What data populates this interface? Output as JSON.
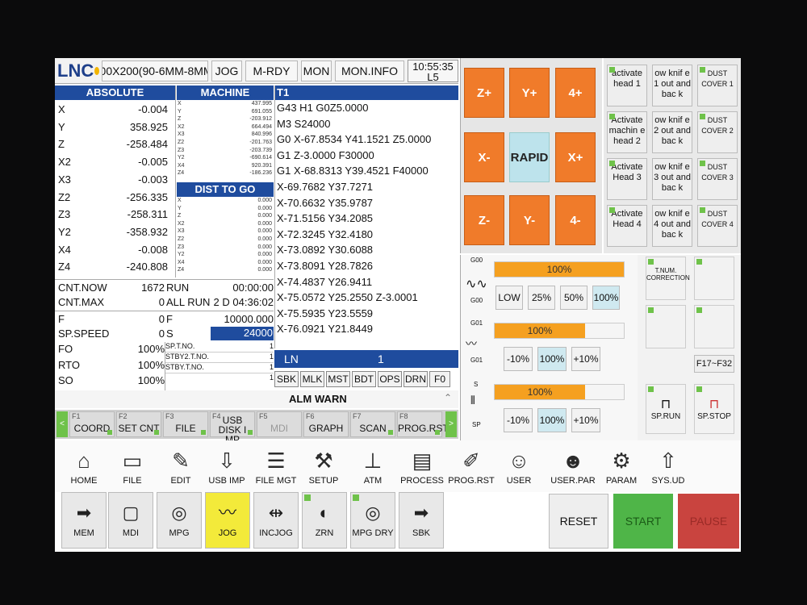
{
  "topbar": {
    "logo": "LNC",
    "program": "200X200(90-6MM-8MM(",
    "mode": "JOG",
    "status": "M-RDY",
    "mon": "MON",
    "mon_info": "MON.INFO",
    "time": "10:55:35",
    "level": "L5"
  },
  "absolute": {
    "title": "ABSOLUTE",
    "rows": [
      {
        "axis": "X",
        "value": "-0.004"
      },
      {
        "axis": "Y",
        "value": "358.925"
      },
      {
        "axis": "Z",
        "value": "-258.484"
      },
      {
        "axis": "X2",
        "value": "-0.005"
      },
      {
        "axis": "X3",
        "value": "-0.003"
      },
      {
        "axis": "Z2",
        "value": "-256.335"
      },
      {
        "axis": "Z3",
        "value": "-258.311"
      },
      {
        "axis": "Y2",
        "value": "-358.932"
      },
      {
        "axis": "X4",
        "value": "-0.008"
      },
      {
        "axis": "Z4",
        "value": "-240.808"
      }
    ]
  },
  "machine": {
    "title": "MACHINE",
    "rows": [
      {
        "axis": "X",
        "value": "437.995"
      },
      {
        "axis": "Y",
        "value": "691.055"
      },
      {
        "axis": "Z",
        "value": "-203.912"
      },
      {
        "axis": "X2",
        "value": "664.494"
      },
      {
        "axis": "X3",
        "value": "840.996"
      },
      {
        "axis": "Z2",
        "value": "-201.763"
      },
      {
        "axis": "Z3",
        "value": "-203.739"
      },
      {
        "axis": "Y2",
        "value": "-690.614"
      },
      {
        "axis": "X4",
        "value": "920.391"
      },
      {
        "axis": "Z4",
        "value": "-186.236"
      }
    ]
  },
  "dist": {
    "title": "DIST TO GO",
    "rows": [
      {
        "axis": "X",
        "value": "0.000"
      },
      {
        "axis": "Y",
        "value": "0.000"
      },
      {
        "axis": "Z",
        "value": "0.000"
      },
      {
        "axis": "X2",
        "value": "0.000"
      },
      {
        "axis": "X3",
        "value": "0.000"
      },
      {
        "axis": "Z2",
        "value": "0.000"
      },
      {
        "axis": "Z3",
        "value": "0.000"
      },
      {
        "axis": "Y2",
        "value": "0.000"
      },
      {
        "axis": "X4",
        "value": "0.000"
      },
      {
        "axis": "Z4",
        "value": "0.000"
      }
    ]
  },
  "counters": {
    "cnt_now_label": "CNT.NOW",
    "cnt_now_value": "1672",
    "cnt_max_label": "CNT.MAX",
    "cnt_max_value": "0",
    "run_label": "RUN",
    "run_value": "00:00:00",
    "all_run_label": "ALL RUN",
    "all_run_value": "2 D 04:36:02"
  },
  "feeds": {
    "f_label": "F",
    "f_value": "0",
    "f_cmd_label": "F",
    "f_cmd_value": "10000.000",
    "sp_label": "SP.SPEED",
    "sp_value": "0",
    "s_label": "S",
    "s_value": "24000",
    "fo_label": "FO",
    "fo_value": "100%",
    "rto_label": "RTO",
    "rto_value": "100%",
    "so_label": "SO",
    "so_value": "100%",
    "spt_label": "SP.T.NO.",
    "spt_value": "1",
    "stby2_label": "STBY2.T.NO.",
    "stby2_value": "1",
    "stby_label": "STBY.T.NO.",
    "stby_value": "1",
    "extra_value": "1"
  },
  "program": {
    "title": "T1",
    "lines": [
      "G43 H1 G0Z5.0000",
      "M3 S24000",
      "G0 X-67.8534 Y41.1521 Z5.0000",
      "G1   Z-3.0000 F30000",
      "G1  X-68.8313 Y39.4521  F40000",
      "X-69.7682 Y37.7271",
      "X-70.6632 Y35.9787",
      "X-71.5156 Y34.2085",
      "X-72.3245 Y32.4180",
      "X-73.0892 Y30.6088",
      "X-73.8091 Y28.7826",
      "X-74.4837 Y26.9411",
      "X-75.0572 Y25.2550 Z-3.0001",
      "X-75.5935 Y23.5559",
      "X-76.0921 Y21.8449"
    ],
    "ln_label": "LN",
    "ln_value": "1",
    "flags": [
      "SBK",
      "MLK",
      "MST",
      "BDT",
      "OPS",
      "DRN",
      "F0"
    ],
    "alm": "ALM",
    "warn": "WARN"
  },
  "fkeys": [
    {
      "fn": "F1",
      "label": "COORD"
    },
    {
      "fn": "F2",
      "label": "SET CNT"
    },
    {
      "fn": "F3",
      "label": "FILE"
    },
    {
      "fn": "F4",
      "label": "USB DISK I MP"
    },
    {
      "fn": "F5",
      "label": "MDI"
    },
    {
      "fn": "F6",
      "label": "GRAPH"
    },
    {
      "fn": "F7",
      "label": "SCAN OPEN"
    },
    {
      "fn": "F8",
      "label": "PROG.RST"
    }
  ],
  "icons": [
    {
      "label": "HOME",
      "icon": "home-icon",
      "glyph": "⌂"
    },
    {
      "label": "FILE",
      "icon": "folder-icon",
      "glyph": "▭"
    },
    {
      "label": "EDIT",
      "icon": "edit-icon",
      "glyph": "✎"
    },
    {
      "label": "USB IMP",
      "icon": "usb-icon",
      "glyph": "⇩"
    },
    {
      "label": "FILE MGT",
      "icon": "file-manager-icon",
      "glyph": "☰"
    },
    {
      "label": "SETUP",
      "icon": "setup-icon",
      "glyph": "⚒"
    },
    {
      "label": "ATM",
      "icon": "tool-magazine-icon",
      "glyph": "⊥"
    },
    {
      "label": "PROCESS",
      "icon": "process-icon",
      "glyph": "▤"
    },
    {
      "label": "PROG.RST",
      "icon": "program-reset-icon",
      "glyph": "✐"
    },
    {
      "label": "USER",
      "icon": "user-icon",
      "glyph": "☺"
    },
    {
      "label": "USER.PAR",
      "icon": "user-param-icon",
      "glyph": "☻"
    },
    {
      "label": "PARAM",
      "icon": "gear-icon",
      "glyph": "⚙"
    },
    {
      "label": "SYS.UD",
      "icon": "upload-icon",
      "glyph": "⇧"
    }
  ],
  "modes": [
    {
      "label": "MEM",
      "glyph": "➡"
    },
    {
      "label": "MDI",
      "glyph": "▢"
    },
    {
      "label": "MPG",
      "glyph": "◎"
    },
    {
      "label": "JOG",
      "glyph": "〰"
    },
    {
      "label": "INCJOG",
      "glyph": "⇹"
    },
    {
      "label": "ZRN",
      "glyph": "◐"
    },
    {
      "label": "MPG DRY",
      "glyph": "◎"
    },
    {
      "label": "SBK",
      "glyph": "➡"
    }
  ],
  "actions": {
    "reset": "RESET",
    "start": "START",
    "pause": "PAUSE"
  },
  "jog": {
    "zplus": "Z+",
    "yplus": "Y+",
    "aplus": "4+",
    "xminus": "X-",
    "rapid": "RAPID",
    "xplus": "X+",
    "zminus": "Z-",
    "yminus": "Y-",
    "aminus": "4-"
  },
  "heads": [
    {
      "activate": "activate head 1",
      "knife": "ow knif e 1 out and bac k",
      "dust": "DUST COVER 1"
    },
    {
      "activate": "Activate machin e head 2",
      "knife": "ow knif e 2 out and bac k",
      "dust": "DUST COVER 2"
    },
    {
      "activate": "Activate Head 3",
      "knife": "ow knif e 3 out and bac k",
      "dust": "DUST COVER 3"
    },
    {
      "activate": "Activate Head 4",
      "knife": "ow knif e 4 out and bac k",
      "dust": "DUST COVER 4"
    }
  ],
  "overrides": {
    "g00_label": "G00",
    "g00_value": "100%",
    "g00_fraction": 1.0,
    "g00_btns": [
      "LOW",
      "25%",
      "50%",
      "100%"
    ],
    "g01_label": "G01",
    "g01_value": "100%",
    "g01_fraction": 0.7,
    "g01_btns": [
      "-10%",
      "100%",
      "+10%"
    ],
    "s_label": "S",
    "sp_label": "SP",
    "s_value": "100%",
    "s_fraction": 0.7,
    "s_btns": [
      "-10%",
      "100%",
      "+10%"
    ]
  },
  "side": {
    "tnum": "T.NUM. CORRECTION",
    "fkeys": "F17~F32",
    "sprun": "SP.RUN",
    "spstop": "SP.STOP"
  }
}
